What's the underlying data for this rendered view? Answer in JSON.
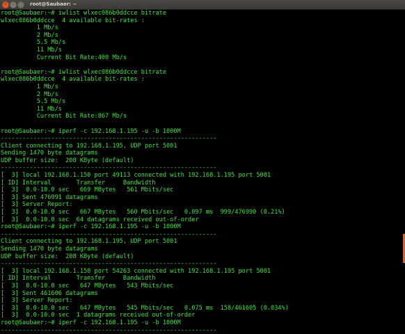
{
  "window": {
    "title": "root@Saubaer: ~",
    "controls": {
      "close": "×",
      "minimize": "−",
      "maximize": "□"
    }
  },
  "terminal": {
    "lines": [
      "root@Saubaer:~# iwlist wlxec086b0ddcce bitrate",
      "wlxec086b0ddcce  4 available bit-rates :",
      "          1 Mb/s",
      "          2 Mb/s",
      "          5.5 Mb/s",
      "          11 Mb/s",
      "          Current Bit Rate:400 Mb/s",
      "",
      "root@Saubaer:~# iwlist wlxec086b0ddcce bitrate",
      "wlxec086b0ddcce  4 available bit-rates :",
      "          1 Mb/s",
      "          2 Mb/s",
      "          5.5 Mb/s",
      "          11 Mb/s",
      "          Current Bit Rate:867 Mb/s",
      "",
      "root@Saubaer:~# iperf -c 192.168.1.195 -u -b 1000M",
      "------------------------------------------------------------",
      "Client connecting to 192.168.1.195, UDP port 5001",
      "Sending 1470 byte datagrams",
      "UDP buffer size:  208 KByte (default)",
      "------------------------------------------------------------",
      "[  3] local 192.168.1.150 port 49113 connected with 192.168.1.195 port 5001",
      "[ ID] Interval       Transfer     Bandwidth",
      "[  3]  0.0-10.0 sec   669 MBytes   561 Mbits/sec",
      "[  3] Sent 476991 datagrams",
      "[  3] Server Report:",
      "[  3]  0.0-10.0 sec   667 MBytes   560 Mbits/sec   0.097 ms  999/476990 (0.21%)",
      "[  3]  0.0-10.0 sec  64 datagrams received out-of-order",
      "root@Saubaer:~# iperf -c 192.168.1.195 -u -b 1000M",
      "------------------------------------------------------------",
      "Client connecting to 192.168.1.195, UDP port 5001",
      "Sending 1470 byte datagrams",
      "UDP buffer size:  208 KByte (default)",
      "------------------------------------------------------------",
      "[  3] local 192.168.1.150 port 54263 connected with 192.168.1.195 port 5001",
      "[ ID] Interval       Transfer     Bandwidth",
      "[  3]  0.0-10.0 sec   647 MBytes   543 Mbits/sec",
      "[  3] Sent 461606 datagrams",
      "[  3] Server Report:",
      "[  3]  0.0-10.0 sec   647 MBytes   545 Mbits/sec   0.075 ms  158/461605 (0.034%)",
      "[  3]  0.0-10.0 sec  1 datagrams received out-of-order",
      "root@Saubaer:~# iperf -c 192.168.1.195 -u -b 1000M",
      "------------------------------------------------------------"
    ]
  },
  "colors": {
    "text": "#3ce23c",
    "background": "#000000",
    "scrollbar_thumb": "#e05a2c"
  }
}
